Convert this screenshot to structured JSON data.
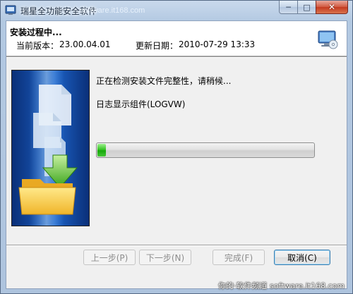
{
  "window": {
    "title": "瑞星全功能安全软件",
    "title_watermark": "software.it168.com"
  },
  "caption_buttons": {
    "minimize": "─",
    "maximize": "□",
    "close": "✕"
  },
  "header": {
    "title": "安装过程中...",
    "version_label": "当前版本：",
    "version_value": "23.00.04.01",
    "date_label": "更新日期：",
    "date_value": "2010-07-29 13:33",
    "icon": "monitor-cd-icon"
  },
  "body": {
    "status": "正在检测安装文件完整性，请稍候...",
    "component": "日志显示组件(LOGVW)",
    "banner_icon": "files-into-folder-icon"
  },
  "progress": {
    "fraction": 0.04,
    "fill_color": "#16a80a"
  },
  "buttons": {
    "prev": "上一步(P)",
    "next": "下一步(N)",
    "finish": "完成(F)",
    "cancel": "取消(C)"
  },
  "watermark": "你的·软件频道  software.it168.com"
}
